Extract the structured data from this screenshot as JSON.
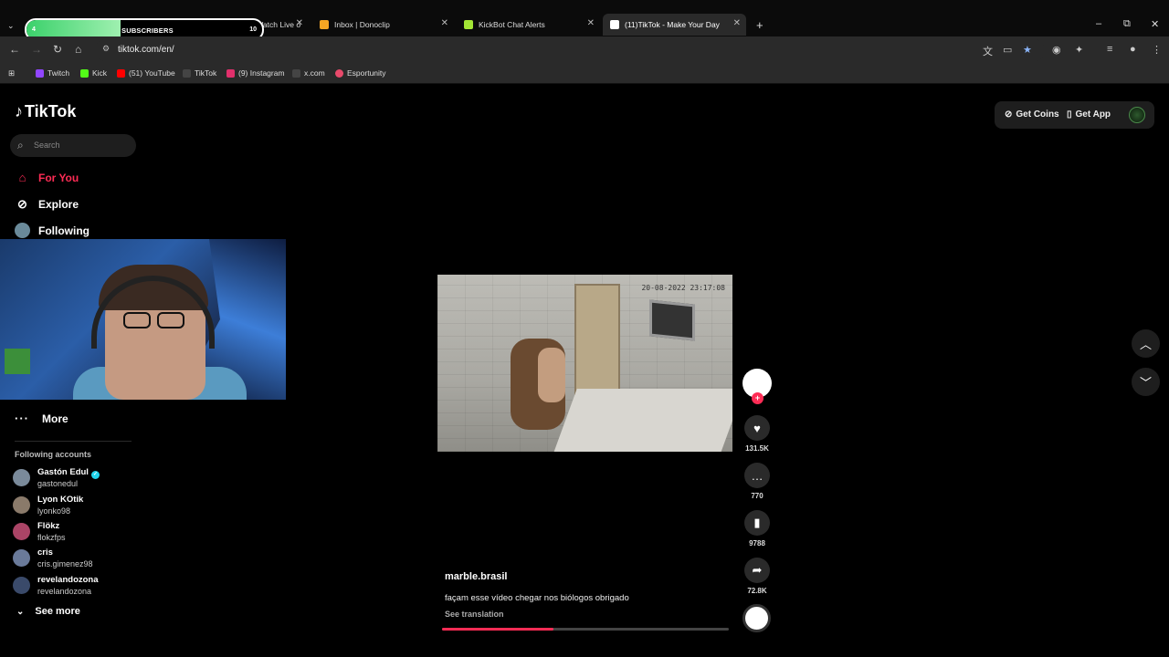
{
  "browser": {
    "tabs": [
      {
        "label": "",
        "color": "#9146ff"
      },
      {
        "label": "LuKaQuu Stream - Watch Live o",
        "color": "#53fc18"
      },
      {
        "label": "Inbox | Donoclip",
        "color": "#f5a623"
      },
      {
        "label": "KickBot Chat Alerts",
        "color": "#a3e635"
      },
      {
        "label": "(11)TikTok - Make Your Day",
        "color": "#ffffff"
      }
    ],
    "subscriber_overlay": {
      "count": "4",
      "label": "SUBSCRIBERS",
      "goal": "10",
      "progress": 0.4
    },
    "url": "tiktok.com/en/",
    "bookmarks": [
      {
        "label": "Twitch",
        "color": "#9146ff"
      },
      {
        "label": "Kick",
        "color": "#53fc18"
      },
      {
        "label": "(51) YouTube",
        "color": "#ff0000"
      },
      {
        "label": "TikTok",
        "color": "#000000"
      },
      {
        "label": "(9) Instagram",
        "color": "#e1306c"
      },
      {
        "label": "x.com",
        "color": "#000000"
      },
      {
        "label": "Esportunity",
        "color": "#e84a6b"
      }
    ]
  },
  "tiktok": {
    "logo": "TikTok",
    "search_placeholder": "Search",
    "nav": {
      "for_you": "For You",
      "explore": "Explore",
      "following": "Following",
      "more": "More"
    },
    "following_accounts_title": "Following accounts",
    "accounts": [
      {
        "name": "Gastón Edul",
        "handle": "gastonedul",
        "verified": true
      },
      {
        "name": "Lyon KOtik",
        "handle": "lyonko98",
        "verified": false
      },
      {
        "name": "Flökz",
        "handle": "flokzfps",
        "verified": false
      },
      {
        "name": "cris",
        "handle": "cris.gimenez98",
        "verified": false
      },
      {
        "name": "revelandozona",
        "handle": "revelandozona",
        "verified": false
      }
    ],
    "see_more": "See more",
    "get_coins": "Get Coins",
    "get_app": "Get App",
    "video": {
      "timestamp": "20-08-2022 23:17:08",
      "author": "marble.brasil",
      "description": "façam esse vídeo chegar nos biólogos obrigado",
      "see_translation": "See translation",
      "progress": 0.39,
      "likes": "131.5K",
      "comments": "770",
      "saves": "9788",
      "shares": "72.8K"
    },
    "accent": "#fe2c55"
  }
}
